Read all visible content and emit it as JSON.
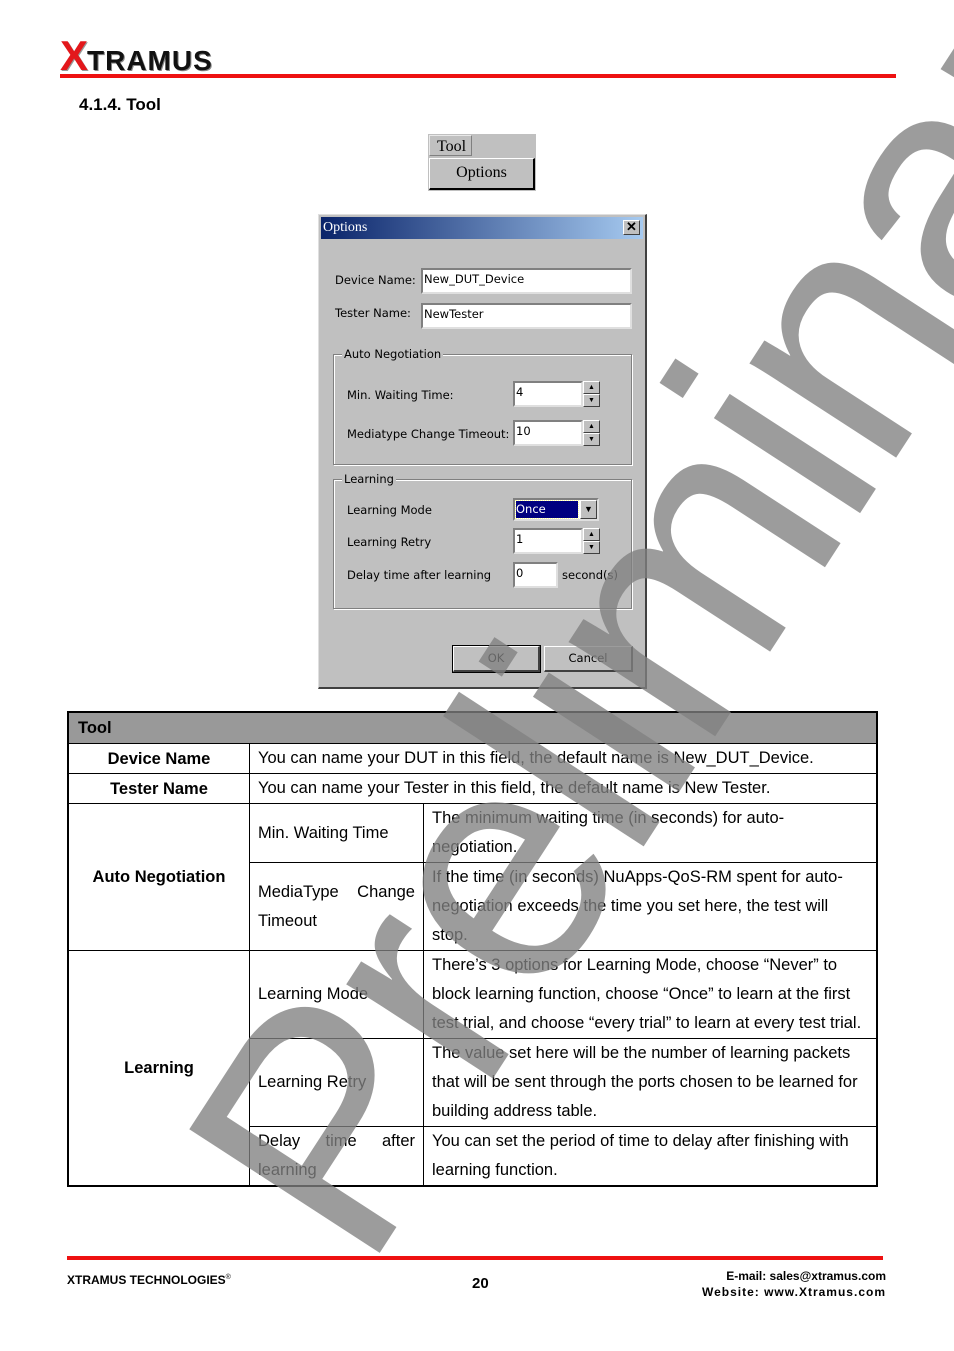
{
  "header": {
    "logo_x": "X",
    "logo_rest": "TRAMUS",
    "section_title": "4.1.4. Tool"
  },
  "menu": {
    "menu_title": "Tool",
    "item": "Options"
  },
  "dialog": {
    "title": "Options",
    "close_glyph": "✕",
    "device_name_label": "Device Name:",
    "device_name_value": "New_DUT_Device",
    "tester_name_label": "Tester Name:",
    "tester_name_value": "NewTester",
    "auto_negotiation": {
      "title": "Auto Negotiation",
      "min_waiting_label": "Min. Waiting Time:",
      "min_waiting_value": "4",
      "mediatype_label": "Mediatype Change Timeout:",
      "mediatype_value": "10"
    },
    "learning": {
      "title": "Learning",
      "mode_label": "Learning Mode",
      "mode_value": "Once",
      "retry_label": "Learning Retry",
      "retry_value": "1",
      "delay_label": "Delay time after learning",
      "delay_value": "0",
      "delay_unit": "second(s)"
    },
    "ok_label": "OK",
    "cancel_label": "Cancel",
    "spin_up": "▲",
    "spin_down": "▼",
    "combo_arrow": "▼"
  },
  "table": {
    "header": "Tool",
    "rows": {
      "device_name": {
        "label": "Device Name",
        "desc": "You can name your DUT in this field, the default name is New_DUT_Device."
      },
      "tester_name": {
        "label": "Tester Name",
        "desc": "You can name your Tester in this field, the default name is New Tester."
      },
      "auto_negotiation": {
        "label": "Auto Negotiation",
        "items": [
          {
            "name": "Min. Waiting Time",
            "desc": "The minimum waiting time (in seconds) for auto-negotiation."
          },
          {
            "name": "MediaType Change Timeout",
            "desc": "If the time (in seconds) NuApps-QoS-RM spent for auto-negotiation exceeds the time you set here, the test will stop."
          }
        ]
      },
      "learning": {
        "label": "Learning",
        "items": [
          {
            "name": "Learning Mode",
            "desc": "There’s 3 options for Learning Mode, choose “Never” to block learning function, choose “Once” to learn at the first test trial, and choose “every trial” to learn at every test trial."
          },
          {
            "name": "Learning Retry",
            "desc": "The value set here will be the number of learning packets that will be sent through the ports chosen to be learned for building address table."
          },
          {
            "name": "Delay time after learning",
            "desc": "You can set the period of time to delay after finishing with learning function."
          }
        ]
      }
    }
  },
  "watermark": "Preliminary",
  "footer": {
    "company": "XTRAMUS TECHNOLOGIES",
    "registered": "®",
    "page_number": "20",
    "email": "E-mail: sales@xtramus.com",
    "website": "Website:  www.Xtramus.com"
  },
  "colors": {
    "brand_red": "#ee1111",
    "table_header_gray": "#999999",
    "titlebar_blue": "#0a246a"
  }
}
